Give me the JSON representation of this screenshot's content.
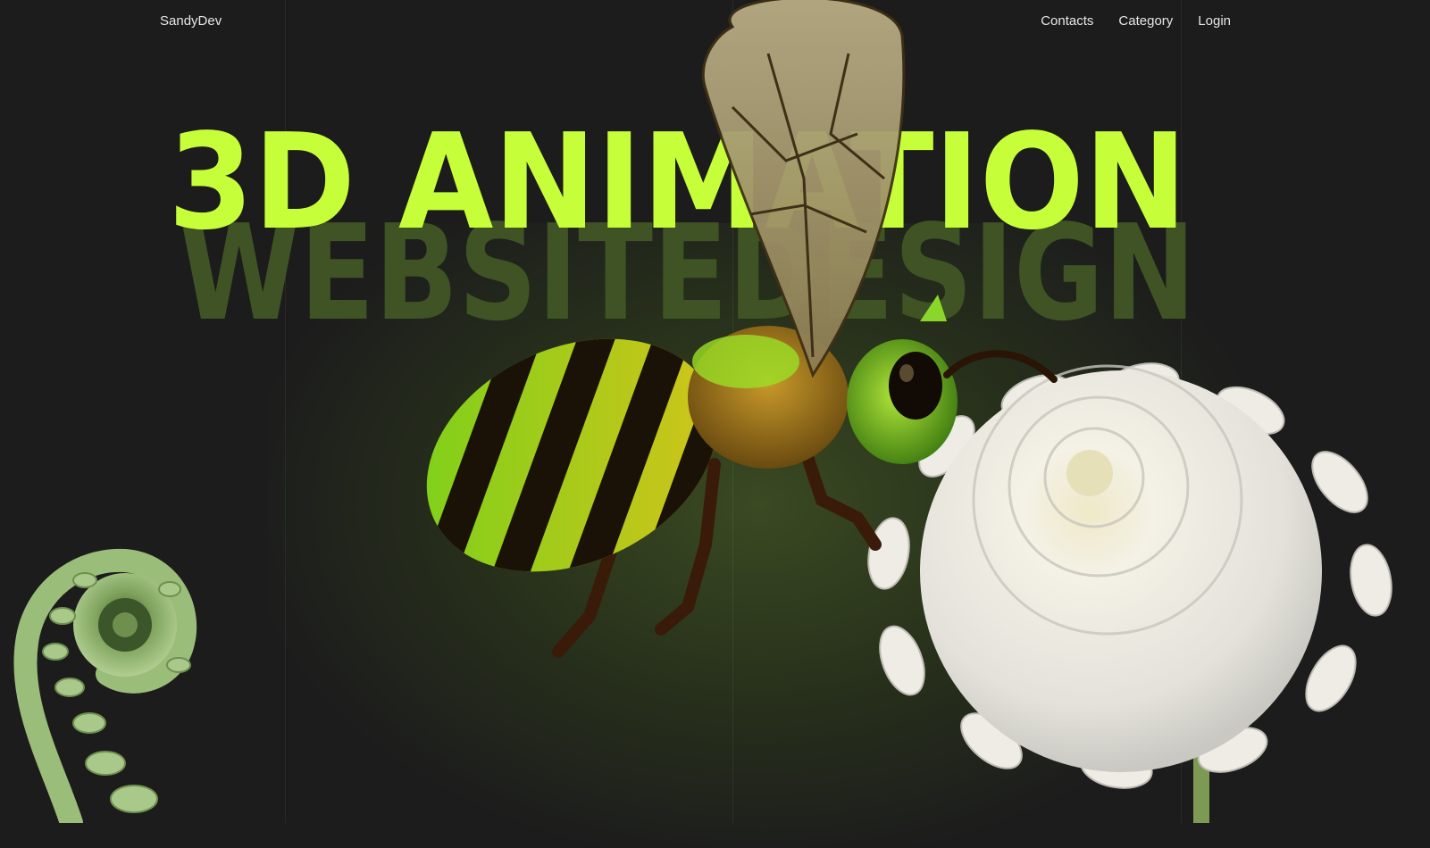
{
  "brand": "SandyDev",
  "nav": {
    "contacts": "Contacts",
    "category": "Category",
    "login": "Login"
  },
  "hero": {
    "title_line1": "3D ANIMATION",
    "title_line2": "WEBSITEDESIGN"
  },
  "colors": {
    "background": "#1c1c1c",
    "accent": "#c6ff3a",
    "accent_dark": "#3f5324"
  },
  "icons": [
    "bee-illustration",
    "dahlia-flower-illustration",
    "fern-frond-illustration"
  ]
}
